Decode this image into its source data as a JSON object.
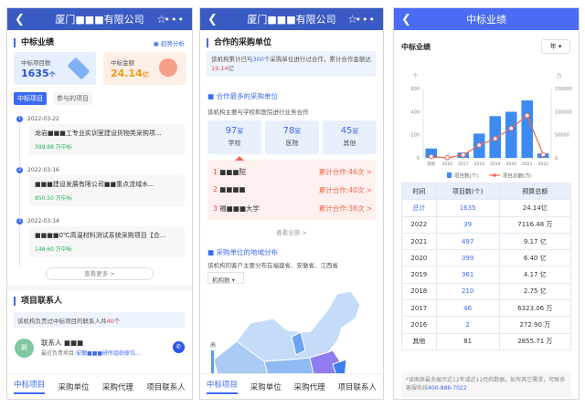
{
  "company_title": "厦门■■■有限公司",
  "panel1": {
    "section_title": "中标业绩",
    "trend_link": "趋势分析",
    "stat_count_label": "中标项目数",
    "stat_count_value": "1635",
    "stat_count_unit": "个",
    "stat_amount_label": "中标金额",
    "stat_amount_value": "24.14",
    "stat_amount_unit": "亿",
    "tabs": [
      "中标项目",
      "参与的项目"
    ],
    "projects": [
      {
        "index": "1",
        "date": "2022-03-22",
        "title": "龙岩■■■工专业实训室建设货物类采购项...",
        "amount": "399.88 万中标"
      },
      {
        "index": "2",
        "date": "2022-03-16",
        "title": "■■■建设发展有限公司■■重点流域水...",
        "amount": "850.50 万中标"
      },
      {
        "index": "3",
        "date": "2022-03-14",
        "title": "■■■■0℃高温材料测试系统采购项目【合...",
        "amount": "148.60 万中标"
      }
    ],
    "more_button": "查看更多 >",
    "contacts_title": "项目联系人",
    "contacts_info_prefix": "该机构负责过中标项目的联系人共",
    "contacts_count": "40",
    "contacts_info_suffix": "个",
    "contact": {
      "avatar": "联",
      "name": "联系人 ■■■",
      "recent_label": "最近负责项目:",
      "recent_project": "安徽■■■研所组织原位..."
    }
  },
  "panel2": {
    "section_title": "合作的采购单位",
    "info_prefix": "该机构累计已与",
    "info_count": "300",
    "info_mid": "个采购单位进行过合作，累计合作金额达",
    "info_amount": "19.14",
    "info_suffix": "亿",
    "top_title": "合作最多的采购单位",
    "top_desc": "该机构主要与学校和医院进行业务合作",
    "categories": [
      {
        "value": "97",
        "unit": "家",
        "label": "学校"
      },
      {
        "value": "78",
        "unit": "家",
        "label": "医院"
      },
      {
        "value": "45",
        "unit": "家",
        "label": "其他"
      }
    ],
    "ranking": [
      {
        "rank": "1",
        "name": "■■■院",
        "count": "累计合作:46次 >"
      },
      {
        "rank": "2",
        "name": "■■■■",
        "count": "累计合作:40次 >"
      },
      {
        "rank": "3",
        "name": "福■■■大学",
        "count": "累计合作:38次 >"
      }
    ],
    "view_all": "查看全部 >",
    "region_title": "采购单位的地域分布",
    "region_desc": "该机构的客户主要分布在福建省、安徽省、江西省",
    "metric_select": "机构数",
    "legend_high": "高"
  },
  "bottom_tabs": [
    "中标项目",
    "采购单位",
    "采购代理",
    "项目联系人"
  ],
  "panel3": {
    "header_title": "中标业绩",
    "section_title": "中标业绩",
    "period_select": "年",
    "table_headers": [
      "时间",
      "项目数(个)",
      "预算总额"
    ],
    "rows": [
      [
        "总计",
        "1635",
        "24.14亿"
      ],
      [
        "2022",
        "39",
        "7116.48 万"
      ],
      [
        "2021",
        "497",
        "9.17 亿"
      ],
      [
        "2020",
        "399",
        "6.40 亿"
      ],
      [
        "2019",
        "361",
        "4.17 亿"
      ],
      [
        "2018",
        "210",
        "2.75 亿"
      ],
      [
        "2017",
        "46",
        "6323.06 万"
      ],
      [
        "2016",
        "2",
        "272.90 万"
      ],
      [
        "其他",
        "81",
        "2855.71 万"
      ]
    ],
    "note": "*该图表最多展示近12年或近12月的数据，如有其它需求，可联系客服热线",
    "hotline": "400-888-7022"
  },
  "chart_data": {
    "type": "bar",
    "categories": [
      "其他",
      "2016",
      "2017",
      "2018",
      "2019",
      "2020",
      "2021",
      "2022"
    ],
    "series": [
      {
        "name": "项目数(个)",
        "type": "bar",
        "axis": "left",
        "values": [
          81,
          2,
          46,
          210,
          361,
          399,
          497,
          39
        ],
        "color": "#3d8bf2"
      },
      {
        "name": "项目总额(万)",
        "type": "line",
        "axis": "right",
        "values": [
          2855.71,
          272.9,
          6323.06,
          27500,
          41700,
          64000,
          91700,
          7116.48
        ],
        "color": "#f0654b"
      }
    ],
    "left_unit": "个",
    "right_unit": "万",
    "ylim_left": [
      0,
      600
    ],
    "ylim_right": [
      0,
      150000
    ],
    "left_ticks": [
      "0",
      "200",
      "400",
      "600"
    ],
    "right_ticks": [
      "0",
      "50000",
      "100000",
      "150000"
    ],
    "legend_position": "bottom"
  }
}
